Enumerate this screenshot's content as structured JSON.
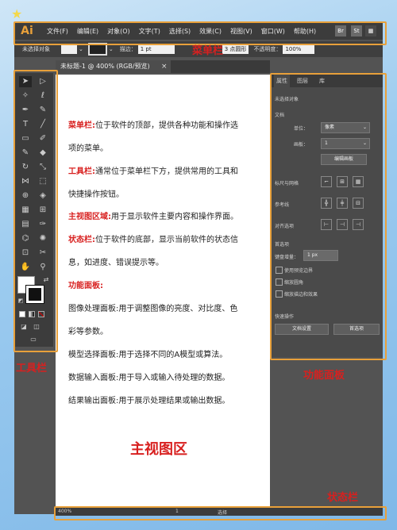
{
  "app": {
    "logo": "Ai"
  },
  "menu": [
    "文件(F)",
    "编辑(E)",
    "对象(O)",
    "文字(T)",
    "选择(S)",
    "效果(C)",
    "视图(V)",
    "窗口(W)",
    "帮助(H)"
  ],
  "menu_right": {
    "b1": "Br",
    "b2": "St"
  },
  "control": {
    "no_selection": "未选择对象",
    "stroke_label": "描边：",
    "stroke_value": "1 pt",
    "brush": "3 点圆形",
    "opacity_label": "不透明度：",
    "opacity_value": "100%"
  },
  "tab": {
    "title": "未标题-1 @ 400% (RGB/预览)",
    "close": "×"
  },
  "panel": {
    "tabs": [
      "属性",
      "图层",
      "库"
    ],
    "no_selection": "未选择对象",
    "doc": "文档",
    "unit_label": "单位：",
    "unit_value": "像素",
    "artboard_label": "画板：",
    "artboard_value": "1",
    "edit_artboard": "编辑画板",
    "rulers": "标尺与网格",
    "guides": "参考线",
    "align": "对齐选项",
    "prefs": "首选项",
    "keyboard_label": "键盘增量：",
    "keyboard_value": "1 px",
    "cb1": "使用预览边界",
    "cb2": "缩放圆角",
    "cb3": "缩放描边和效果",
    "quick": "快速操作",
    "doc_setup": "文档设置",
    "pref_btn": "首选项"
  },
  "status": {
    "zoom": "400%",
    "page": "1",
    "select": "选择"
  },
  "content": {
    "l1_red": "菜单栏:",
    "l1": "位于软件的顶部，提供各种功能和操作选",
    "l1b": "项的菜单。",
    "l2_red": "工具栏:",
    "l2": "通常位于菜单栏下方，提供常用的工具和",
    "l2b": "快捷操作按钮。",
    "l3_red": "主视图区域:",
    "l3": "用于显示软件主要内容和操作界面。",
    "l4_red": "状态栏:",
    "l4": "位于软件的底部，显示当前软件的状态信",
    "l4b": "息，如进度、错误提示等。",
    "l5_red": "功能面板:",
    "l6": "图像处理面板:用于调整图像的亮度、对比度、色",
    "l6b": "彩等参数。",
    "l7": "模型选择面板:用于选择不同的A模型或算法。",
    "l8": "数据输入面板:用于导入或输入待处理的数据。",
    "l9": "结果输出面板:用于展示处理结果或输出数据。"
  },
  "labels": {
    "menubar": "菜单栏",
    "toolbar": "工具栏",
    "main": "主视图区",
    "panel": "功能面板",
    "status": "状态栏"
  },
  "colors": {
    "annotation": "#e8a03a",
    "label_red": "#d8201f"
  }
}
